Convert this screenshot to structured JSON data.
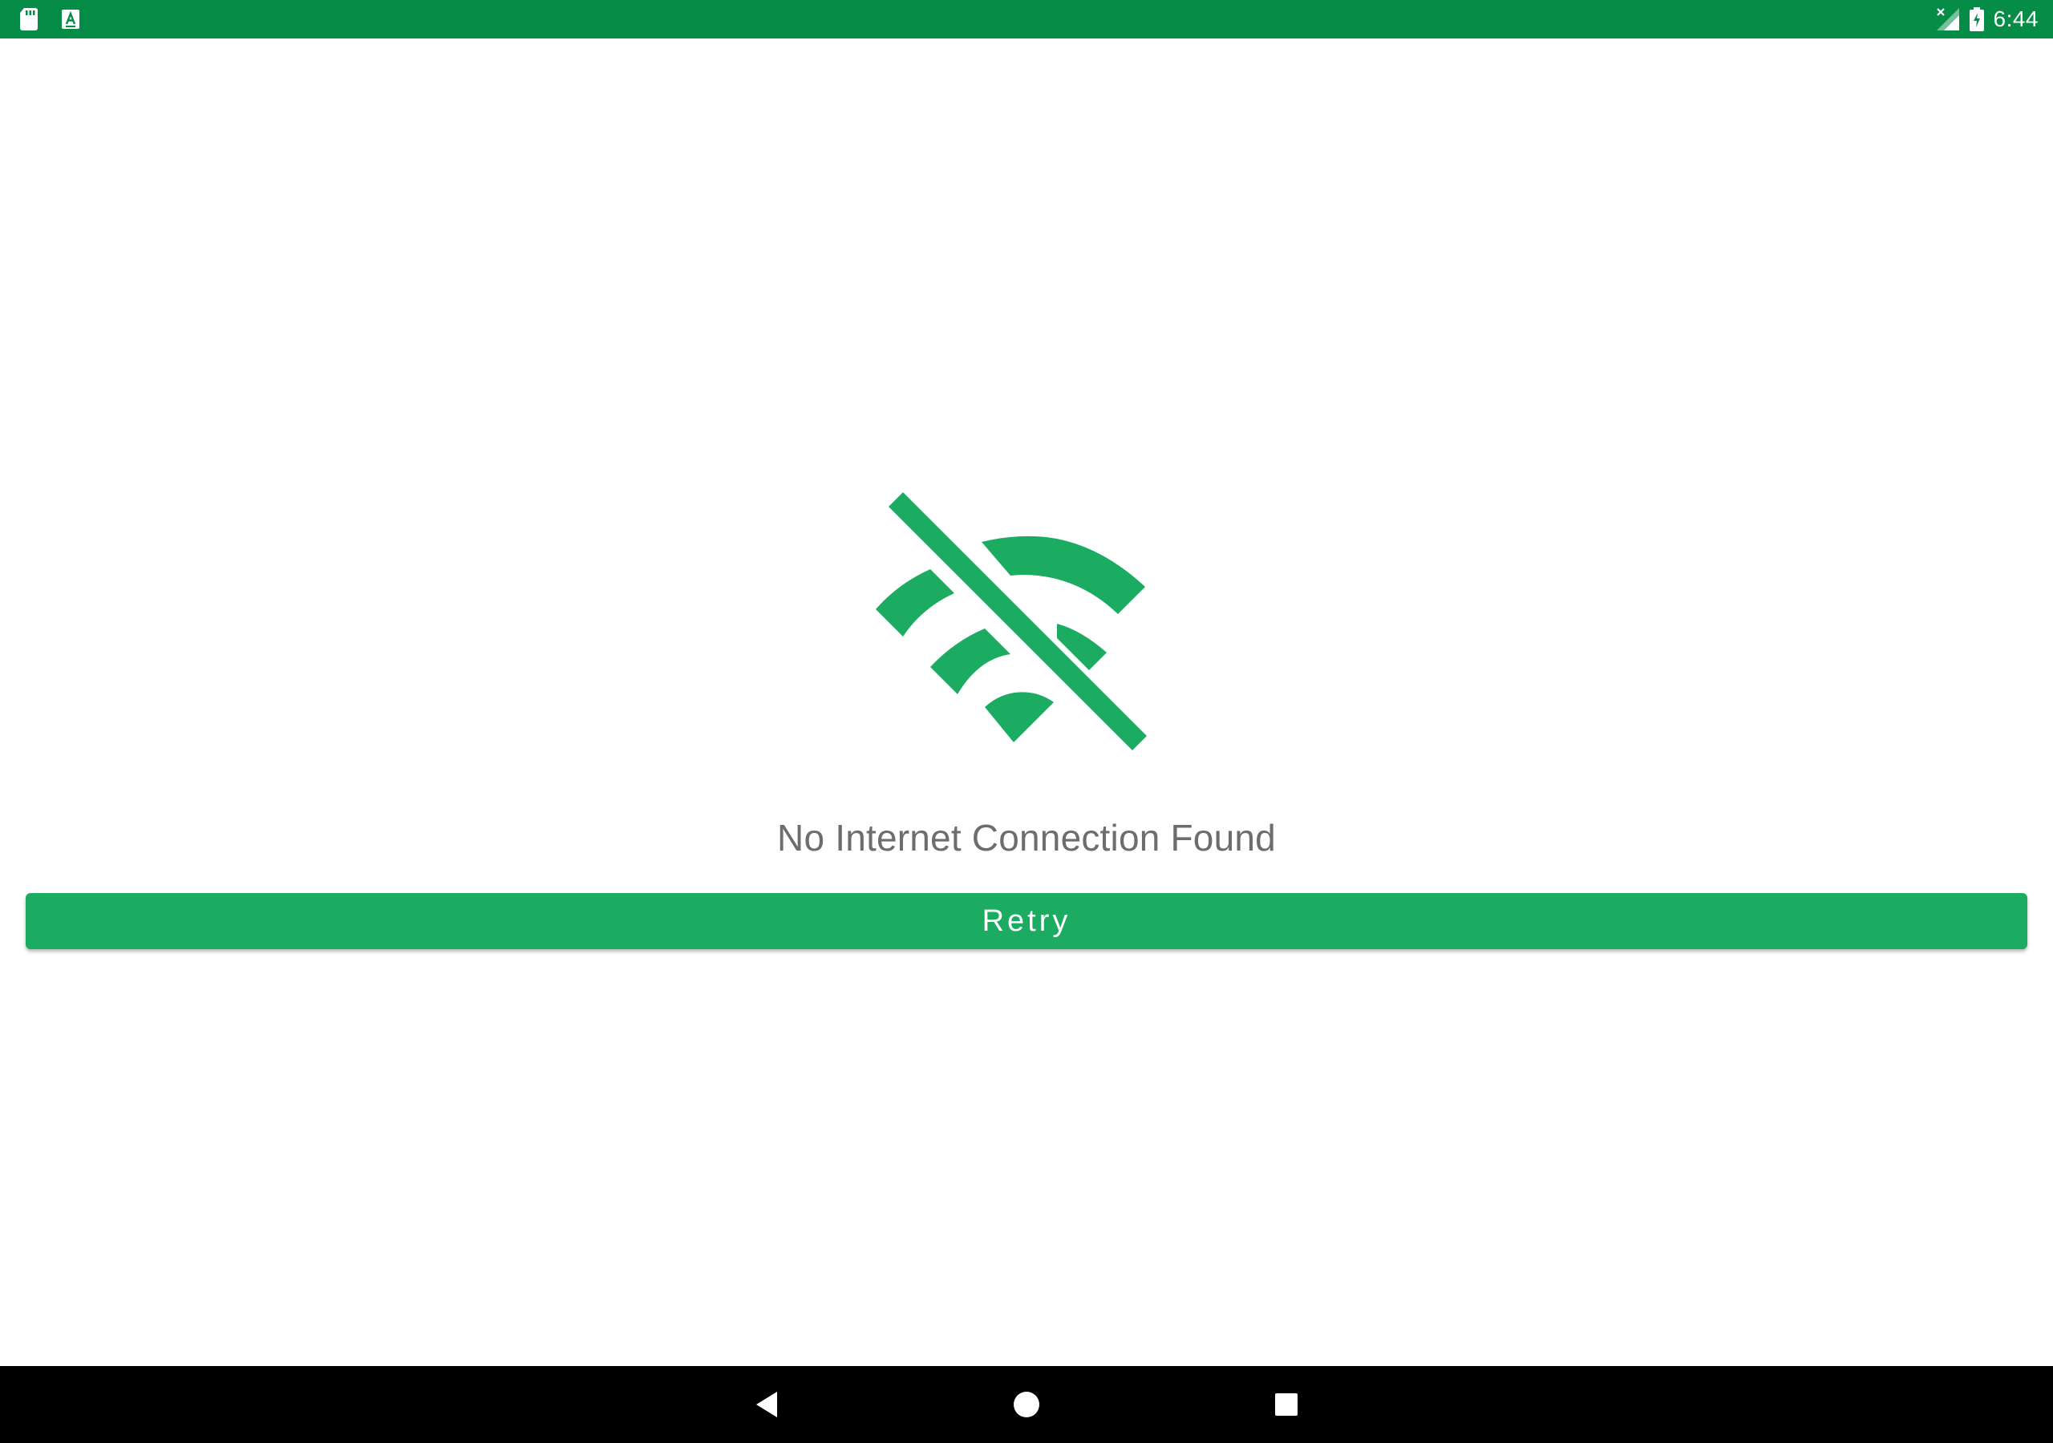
{
  "status_bar": {
    "time": "6:44",
    "background_color": "#058c47",
    "left_icons": [
      "sd-card-icon",
      "keyboard-a-icon"
    ],
    "right_icons": [
      "signal-no-service-icon",
      "battery-charging-icon"
    ]
  },
  "main": {
    "illustration_icon": "wifi-off-icon",
    "message": "No Internet Connection Found",
    "retry_label": "Retry",
    "accent_color": "#1bac62",
    "message_color": "#6d6d6d"
  },
  "nav_bar": {
    "background_color": "#000000",
    "buttons": [
      "back-icon",
      "home-icon",
      "recents-icon"
    ]
  }
}
